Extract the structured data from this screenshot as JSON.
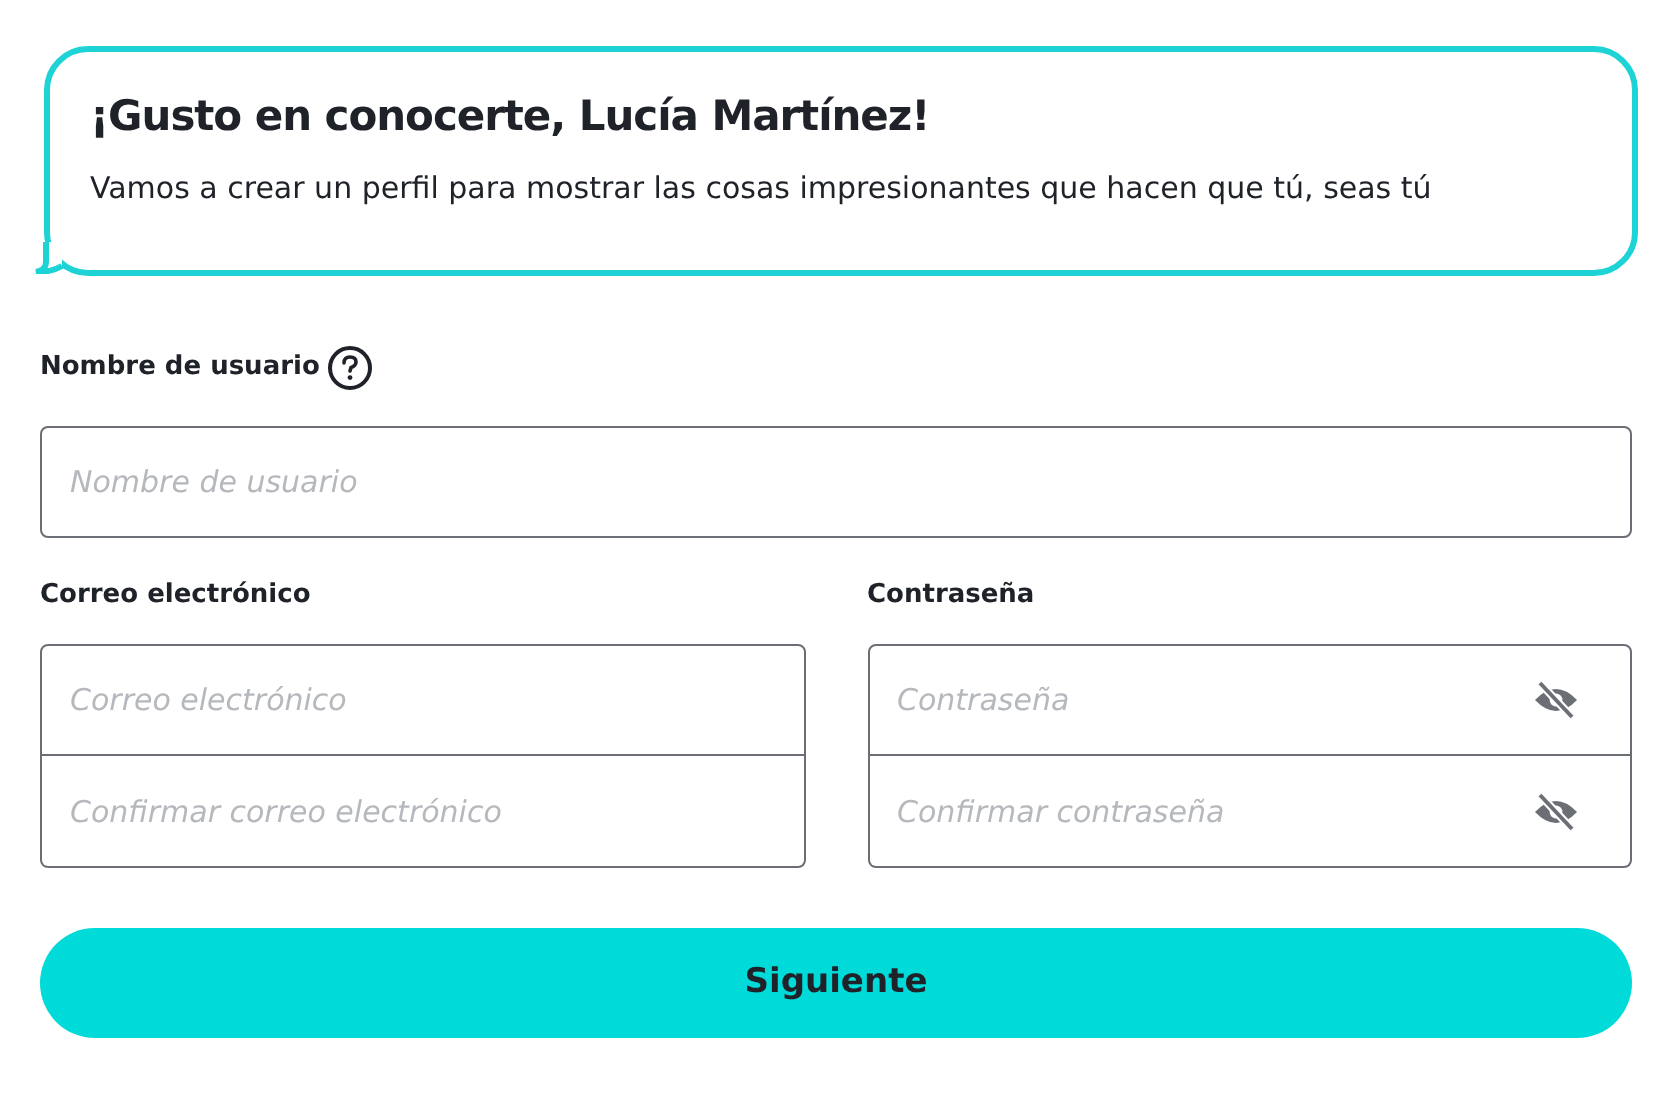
{
  "greeting": {
    "title": "¡Gusto en conocerte, Lucía Martínez!",
    "message": "Vamos a crear un perfil para mostrar las cosas impresionantes que hacen que tú, seas tú"
  },
  "username": {
    "label": "Nombre de usuario",
    "placeholder": "Nombre de usuario"
  },
  "email": {
    "label": "Correo electrónico",
    "fields": [
      {
        "placeholder": "Correo electrónico"
      },
      {
        "placeholder": "Confirmar correo electrónico"
      }
    ]
  },
  "password": {
    "label": "Contraseña",
    "fields": [
      {
        "placeholder": "Contraseña"
      },
      {
        "placeholder": "Confirmar contraseña"
      }
    ]
  },
  "submit_button": "Siguiente"
}
